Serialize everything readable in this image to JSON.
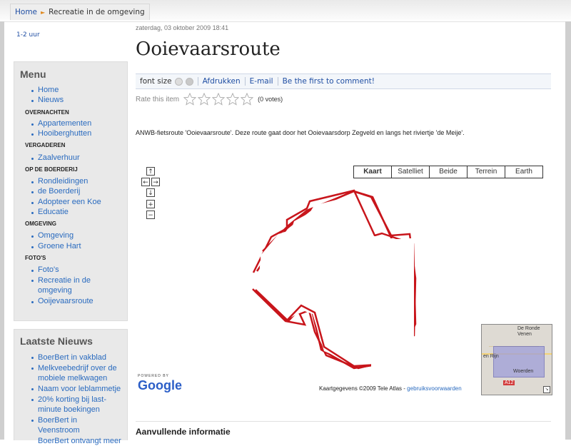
{
  "breadcrumb": {
    "home": "Home",
    "current": "Recreatie in de omgeving"
  },
  "left_date": "1-2 uur",
  "menu": {
    "title": "Menu",
    "items": [
      {
        "type": "link",
        "label": "Home"
      },
      {
        "type": "link",
        "label": "Nieuws"
      },
      {
        "type": "section",
        "label": "OVERNACHTEN"
      },
      {
        "type": "link",
        "label": "Appartementen"
      },
      {
        "type": "link",
        "label": "Hooiberghutten"
      },
      {
        "type": "section",
        "label": "VERGADEREN"
      },
      {
        "type": "link",
        "label": "Zaalverhuur"
      },
      {
        "type": "section",
        "label": "OP DE BOERDERIJ"
      },
      {
        "type": "link",
        "label": "Rondleidingen"
      },
      {
        "type": "link",
        "label": "de Boerderij"
      },
      {
        "type": "link",
        "label": "Adopteer een Koe"
      },
      {
        "type": "link",
        "label": "Educatie"
      },
      {
        "type": "section",
        "label": "OMGEVING"
      },
      {
        "type": "link",
        "label": "Omgeving"
      },
      {
        "type": "link",
        "label": "Groene Hart"
      },
      {
        "type": "section",
        "label": "FOTO'S"
      },
      {
        "type": "link",
        "label": "Foto's"
      },
      {
        "type": "link",
        "label": "Recreatie in de omgeving"
      },
      {
        "type": "link",
        "label": "Ooijevaarsroute"
      }
    ]
  },
  "news": {
    "title": "Laatste Nieuws",
    "items": [
      "BoerBert in vakblad",
      "Melkveebedrijf over de mobiele melkwagen",
      "Naam voor leblammetje",
      "20% korting bij last-minute boekingen",
      "BoerBert in Veenstroom",
      "BoerBert ontvangt meer"
    ]
  },
  "article": {
    "date": "zaterdag, 03 oktober 2009 18:41",
    "title": "Ooievaarsroute",
    "toolbar": {
      "font_size": "font size",
      "print": "Afdrukken",
      "email": "E-mail",
      "comment": "Be the first to comment!"
    },
    "rating": {
      "label": "Rate this item",
      "votes": "(0 votes)",
      "stars": 0,
      "max": 5
    },
    "description": "ANWB-fietsroute 'Ooievaarsroute'. Deze route gaat door het Ooievaarsdorp Zegveld en langs het riviertje 'de Meije'.",
    "section_title": "Aanvullende informatie"
  },
  "map": {
    "types": [
      "Kaart",
      "Satelliet",
      "Beide",
      "Terrein",
      "Earth"
    ],
    "active_type": "Kaart",
    "powered_by": "POWERED BY",
    "google_logo": "Google",
    "data_text": "Kaartgegevens ©2009 Tele Atlas - ",
    "data_link": "gebruiksvoorwaarden",
    "overview_labels": [
      "De Ronde Venen",
      "en Rijn",
      "Woerden",
      "A12"
    ],
    "route_color": "#c8151b"
  },
  "colors": {
    "link": "#2a6bbf",
    "panel_bg": "#e9e9e9"
  }
}
